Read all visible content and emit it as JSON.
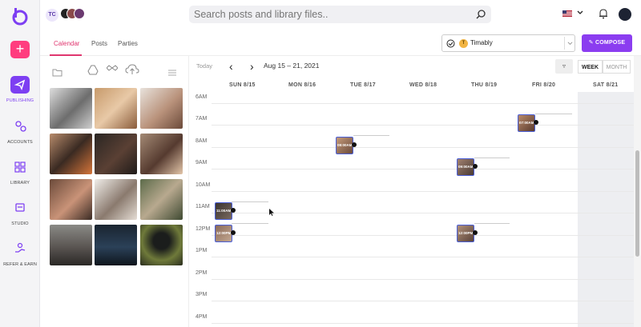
{
  "nav": {
    "items": [
      {
        "label": "PUBLISHING",
        "icon": "send-icon"
      },
      {
        "label": "ACCOUNTS",
        "icon": "accounts-icon"
      },
      {
        "label": "LIBRARY",
        "icon": "grid-icon"
      },
      {
        "label": "STUDIO",
        "icon": "studio-icon"
      },
      {
        "label": "REFER & EARN",
        "icon": "gift-icon"
      }
    ]
  },
  "topbar": {
    "avatar_initials": "TC",
    "search_placeholder": "Search posts and library files.."
  },
  "tabs": [
    "Calendar",
    "Posts",
    "Parties"
  ],
  "account_selector": {
    "initial": "T",
    "name": "Timably"
  },
  "compose_label": "COMPOSE",
  "calendar": {
    "today_label": "Today",
    "range": "Aug 15 – 21, 2021",
    "view_week": "WEEK",
    "view_month": "MONTH",
    "days": [
      "SUN 8/15",
      "MON 8/16",
      "TUE 8/17",
      "WED 8/18",
      "THU 8/19",
      "FRI 8/20",
      "SAT 8/21"
    ],
    "hours": [
      "6AM",
      "7AM",
      "8AM",
      "9AM",
      "10AM",
      "11AM",
      "12PM",
      "1PM",
      "2PM",
      "3PM",
      "4PM"
    ],
    "posts": [
      {
        "day": 5,
        "time": "07:00AM"
      },
      {
        "day": 2,
        "time": "08:00AM"
      },
      {
        "day": 4,
        "time": "09:00AM"
      },
      {
        "day": 0,
        "time": "11:00AM"
      },
      {
        "day": 0,
        "time": "12:00PM"
      },
      {
        "day": 4,
        "time": "12:00PM"
      }
    ]
  },
  "colors": {
    "accent": "#7d3ff2",
    "pink": "#ff3d7f",
    "tab_active": "#e0366f"
  }
}
